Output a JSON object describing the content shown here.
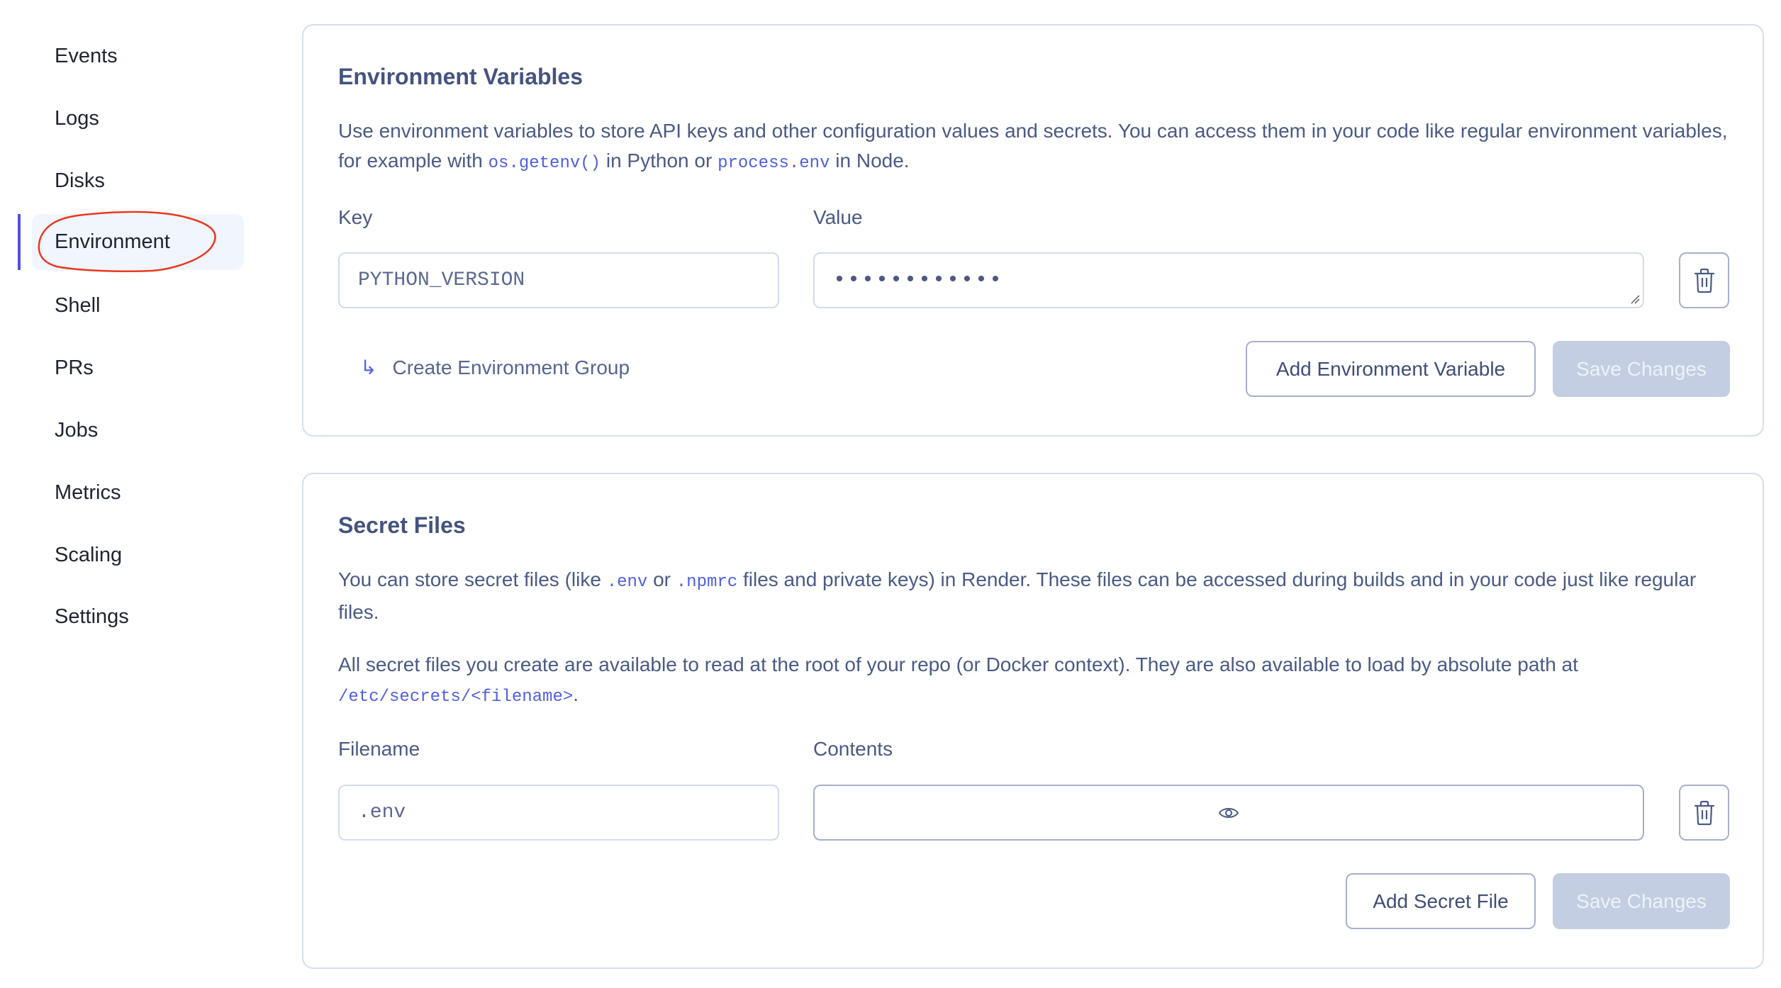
{
  "sidebar": {
    "items": [
      {
        "label": "Events"
      },
      {
        "label": "Logs"
      },
      {
        "label": "Disks"
      },
      {
        "label": "Environment",
        "active": true
      },
      {
        "label": "Shell"
      },
      {
        "label": "PRs"
      },
      {
        "label": "Jobs"
      },
      {
        "label": "Metrics"
      },
      {
        "label": "Scaling"
      },
      {
        "label": "Settings"
      }
    ]
  },
  "env_vars": {
    "title": "Environment Variables",
    "description_1": "Use environment variables to store API keys and other configuration values and secrets. You can access them in your code like regular environment variables, for example with ",
    "code_1": "os.getenv()",
    "description_2": " in Python or ",
    "code_2": "process.env",
    "description_3": " in Node.",
    "key_label": "Key",
    "value_label": "Value",
    "rows": [
      {
        "key": "PYTHON_VERSION",
        "value_masked": "••••••••••••"
      }
    ],
    "create_group_label": "Create Environment Group",
    "add_button": "Add Environment Variable",
    "save_button": "Save Changes"
  },
  "secret_files": {
    "title": "Secret Files",
    "p1_a": "You can store secret files (like ",
    "p1_code1": ".env",
    "p1_b": " or ",
    "p1_code2": ".npmrc",
    "p1_c": " files and private keys) in Render. These files can be accessed during builds and in your code just like regular files.",
    "p2_a": "All secret files you create are available to read at the root of your repo (or Docker context). They are also available to load by absolute path at ",
    "p2_code": "/etc/secrets/<filename>",
    "p2_b": ".",
    "filename_label": "Filename",
    "contents_label": "Contents",
    "rows": [
      {
        "filename": ".env",
        "contents_icon": "eye-icon"
      }
    ],
    "add_button": "Add Secret File",
    "save_button": "Save Changes"
  },
  "colors": {
    "accent": "#4f52d9",
    "annotation": "#e8381f",
    "code": "#4f5fe0",
    "disabled_button": "#c3cee2"
  }
}
